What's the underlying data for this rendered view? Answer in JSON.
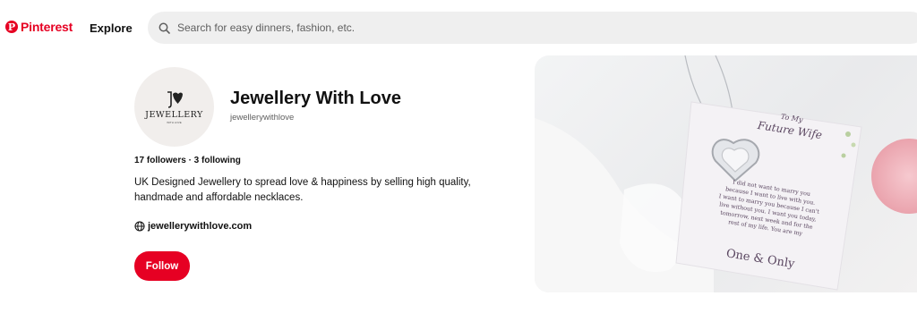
{
  "header": {
    "logo_text": "Pinterest",
    "explore_label": "Explore",
    "search_placeholder": "Search for easy dinners, fashion, etc."
  },
  "profile": {
    "avatar_brand": "JEWELLERY",
    "avatar_sub": "WITH LOVE",
    "name": "Jewellery With Love",
    "handle": "jewellerywithlove",
    "stats": "17 followers · 3 following",
    "bio": "UK Designed Jewellery to spread love & happiness by selling high quality, handmade and affordable necklaces.",
    "website": "jewellerywithlove.com",
    "follow_label": "Follow"
  },
  "cover": {
    "card_title_1": "To My",
    "card_title_2": "Future Wife",
    "card_lines": [
      "I did not want to marry you",
      "because I want to live with you.",
      "I want to marry you because I can't",
      "live without you. I want you today,",
      "tomorrow, next week and for the",
      "rest of my life. You are my"
    ],
    "card_footer": "One & Only"
  },
  "colors": {
    "brand": "#e60023",
    "search_bg": "#efefef"
  }
}
